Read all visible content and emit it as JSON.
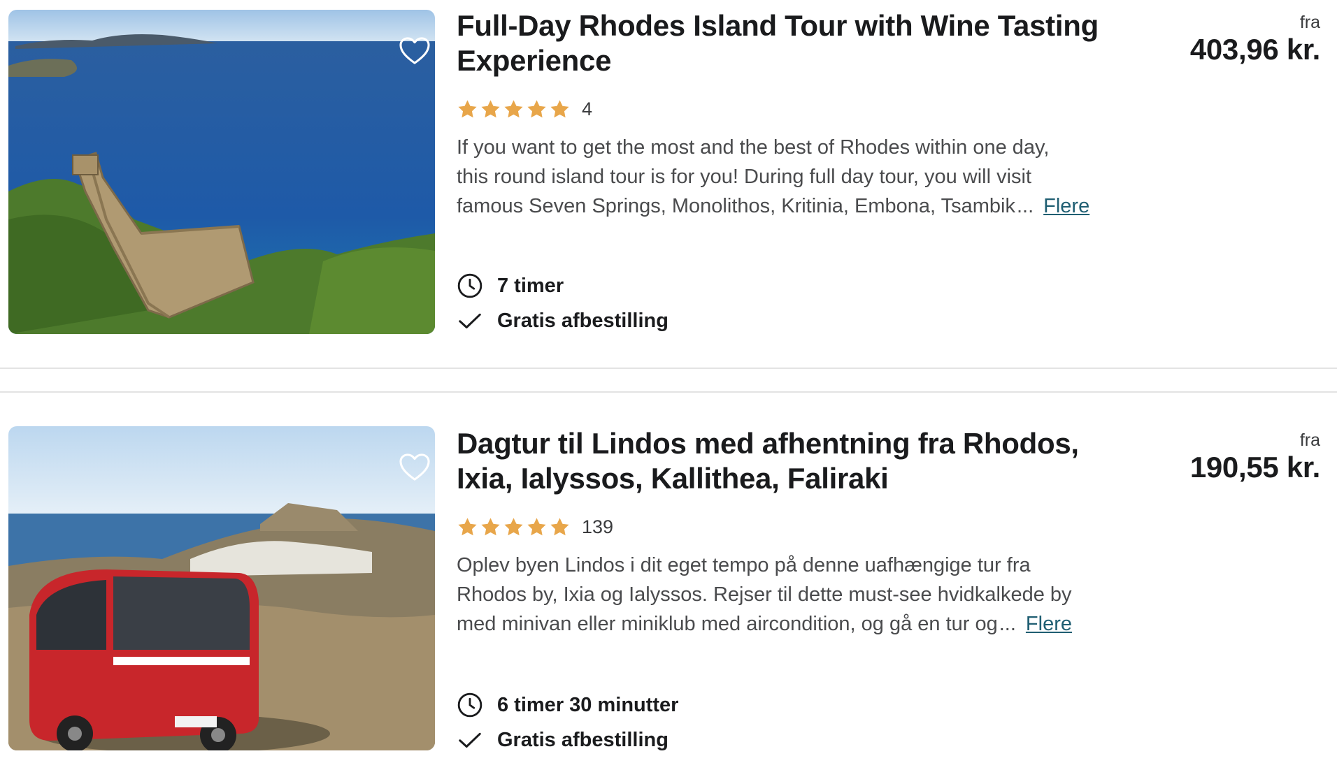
{
  "listings": [
    {
      "title": "Full-Day Rhodes Island Tour with Wine Tasting Experience",
      "rating_count": "4",
      "stars": 5,
      "description_lines": [
        "If you want to get the most and the best of Rhodes within one day,",
        "this round island tour is for you! During full day tour, you will visit",
        "famous Seven Springs, Monolithos, Kritinia, Embona, Tsambik"
      ],
      "ellipsis": "...",
      "more_label": "Flere",
      "duration": "7 timer",
      "cancellation": "Gratis afbestilling",
      "price_prefix": "fra",
      "price": "403,96 kr.",
      "image_icon": "castle-coast-photo"
    },
    {
      "title": "Dagtur til Lindos med afhentning fra Rhodos, Ixia, Ialyssos, Kallithea, Faliraki",
      "rating_count": "139",
      "stars": 5,
      "description_lines": [
        "Oplev byen Lindos i dit eget tempo på denne uafhængige tur fra",
        "Rhodos by, Ixia og Ialyssos. Rejser til dette must-see hvidkalkede by",
        "med minivan eller miniklub med aircondition, og gå en tur og"
      ],
      "ellipsis": "...",
      "more_label": "Flere",
      "duration": "6 timer 30 minutter",
      "cancellation": "Gratis afbestilling",
      "price_prefix": "fra",
      "price": "190,55 kr.",
      "image_icon": "red-bus-lindos-photo"
    }
  ],
  "colors": {
    "star": "#e8a64a",
    "link": "#1f5e72",
    "text": "#1a1b1d",
    "muted": "#4a4b4d",
    "divider": "#e3e3e3"
  }
}
